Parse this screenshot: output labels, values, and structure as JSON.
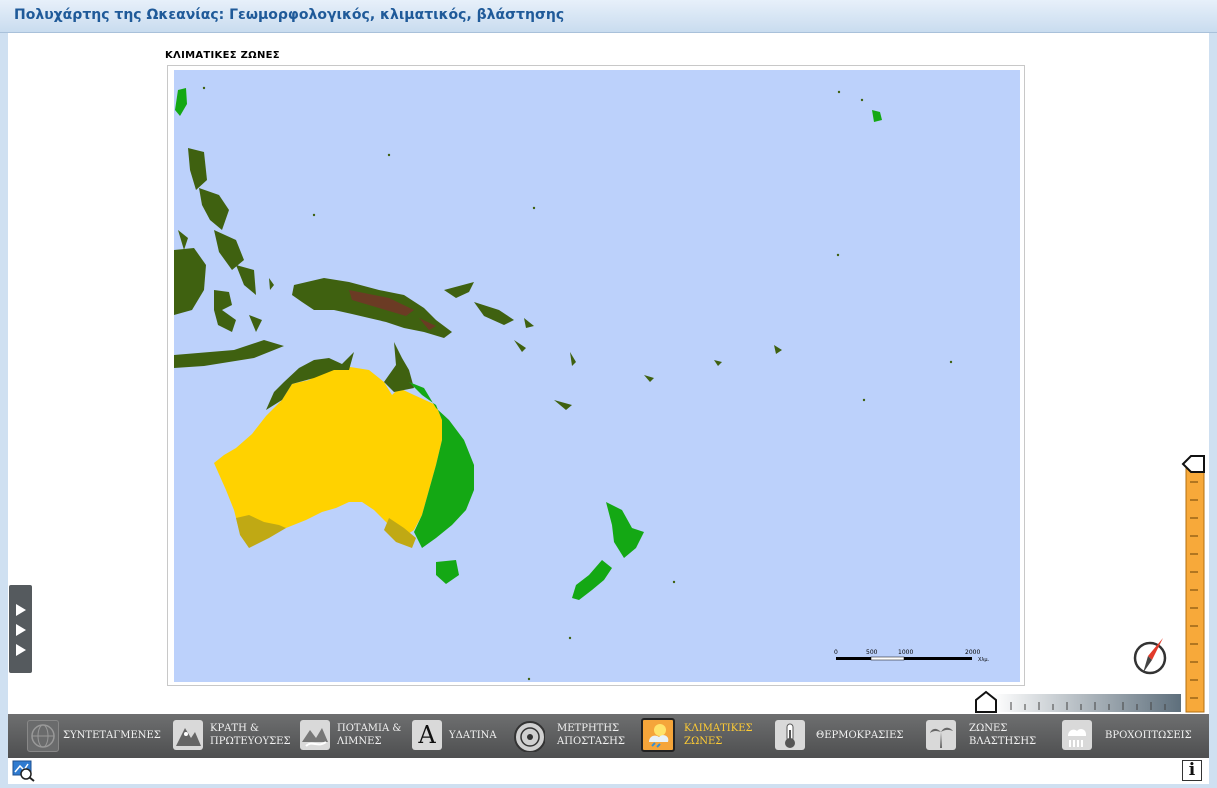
{
  "window": {
    "title": "Πολυχάρτης της Ωκεανίας: Γεωμορφολογικός, κλιματικός, βλάστησης"
  },
  "map": {
    "heading": "ΚΛΙΜΑΤΙΚΕΣ ΖΩΝΕΣ",
    "scale_bar": {
      "ticks": [
        "0",
        "500",
        "1000",
        "2000"
      ],
      "unit": "Χλμ."
    },
    "colors": {
      "ocean": "#bcd1fb",
      "tropical_forest": "#3f6110",
      "humid_subtropical": "#14a814",
      "dry_desert": "#ffd200",
      "mediterranean": "#c0a914",
      "highland": "#6b3b24"
    }
  },
  "toolbar": {
    "items": [
      {
        "label": "ΣΥΝΤΕΤΑΓΜΕΝΕΣ",
        "icon": "globe-grid-icon",
        "active": false
      },
      {
        "label": "ΚΡΑΤΗ &\nΠΡΩΤΕΥΟΥΣΕΣ",
        "line1": "ΚΡΑΤΗ &",
        "line2": "ΠΡΩΤΕΥΟΥΣΕΣ",
        "icon": "states-capitals-icon",
        "active": false
      },
      {
        "label": "ΠΟΤΑΜΙΑ &\nΛΙΜΝΕΣ",
        "line1": "ΠΟΤΑΜΙΑ &",
        "line2": "ΛΙΜΝΕΣ",
        "icon": "rivers-lakes-icon",
        "active": false
      },
      {
        "label": "ΥΔΑΤΙΝΑ",
        "icon": "letter-a-icon",
        "active": false
      },
      {
        "label": "ΜΕΤΡΗΤΗΣ\nΑΠΟΣΤΑΣΗΣ",
        "line1": "ΜΕΤΡΗΤΗΣ",
        "line2": "ΑΠΟΣΤΑΣΗΣ",
        "icon": "distance-meter-icon",
        "active": false
      },
      {
        "label": "ΚΛΙΜΑΤΙΚΕΣ\nΖΩΝΕΣ",
        "line1": "ΚΛΙΜΑΤΙΚΕΣ",
        "line2": "ΖΩΝΕΣ",
        "icon": "climate-zones-icon",
        "active": true
      },
      {
        "label": "ΘΕΡΜΟΚΡΑΣΙΕΣ",
        "icon": "thermometer-icon",
        "active": false
      },
      {
        "label": "ΖΩΝΕΣ\nΒΛΑΣΤΗΣΗΣ",
        "line1": "ΖΩΝΕΣ",
        "line2": "ΒΛΑΣΤΗΣΗΣ",
        "icon": "palm-tree-icon",
        "active": false
      },
      {
        "label": "ΒΡΟΧΟΠΤΩΣΕΙΣ",
        "icon": "rain-cloud-icon",
        "active": false
      }
    ]
  },
  "info_button": {
    "label": "i"
  }
}
